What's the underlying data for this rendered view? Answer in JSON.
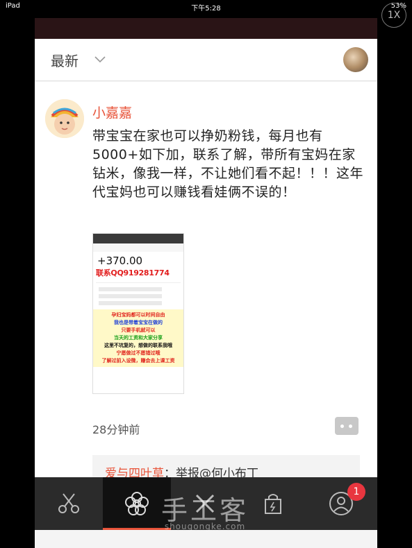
{
  "status_bar": {
    "device": "iPad",
    "time": "下午5:28",
    "battery": "53%"
  },
  "zoom_badge": "1X",
  "header": {
    "title": "最新",
    "chevron_icon": "chevron-down-icon"
  },
  "post": {
    "author": "小嘉嘉",
    "body": "带宝宝在家也可以挣奶粉钱，每月也有5000+如下加，联系了解，带所有宝妈在家钻米，像我一样，不让她们看不起！！！这年代宝妈也可以赚钱看娃俩不误的！",
    "image": {
      "amount": "+370.00",
      "qq": "联系QQ919281774",
      "lines": [
        "孕妇宝妈都可以时间自由",
        "我也是带着宝宝在做的",
        "只要手机就可以",
        "当天的工资和大家分享",
        "这里不坑复的，想做的联系我哦",
        "宁愿做过不愿错过哦",
        "了解过前入设微，赚会去上课工资"
      ],
      "line_colors": [
        "#e0251d",
        "#1d3fd6",
        "#e0251d",
        "#18a018",
        "#111111",
        "#e0251d",
        "#e0251d"
      ]
    },
    "time": "28分钟前",
    "reply": {
      "name": "爱与四叶草",
      "text": "：举报@何小布丁"
    }
  },
  "nav": {
    "items": [
      {
        "icon": "scissors-icon"
      },
      {
        "icon": "flower-icon",
        "active": true
      },
      {
        "icon": "tools-icon"
      },
      {
        "icon": "shopping-bag-icon"
      },
      {
        "icon": "user-icon",
        "badge": "1"
      }
    ]
  },
  "watermark": {
    "text": "手工客",
    "url": "shougongke.com"
  },
  "colors": {
    "accent": "#e8543a",
    "badge": "#e8363f",
    "nav_bg": "#2b2b2b"
  }
}
